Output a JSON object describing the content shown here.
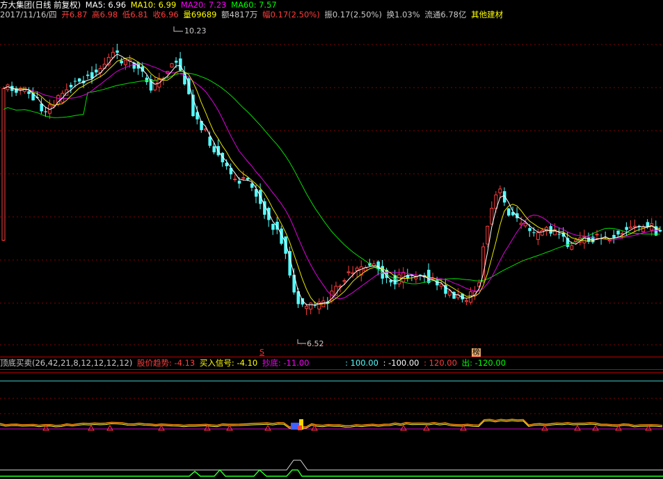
{
  "header": {
    "stock": "方大集团(日线 前复权)",
    "ma5_label": "MA5: 6.96",
    "ma10_label": "MA10: 6.99",
    "ma20_label": "MA20: 7.23",
    "ma60_label": "MA60: 7.57",
    "date": "2017/11/16/四",
    "open_label": "开6.87",
    "high_label": "高6.98",
    "low_label": "低6.81",
    "close_label": "收6.96",
    "volume_label": "量69689",
    "amount_label": "额4817万",
    "change_label": "幅0.17(2.50%)",
    "amplitude_label": "振0.17(2.50%)",
    "turnover_label": "换1.03%",
    "float_label": "流通6.78亿",
    "sector": "其他建材"
  },
  "chart": {
    "high_marker": "10.23",
    "low_marker": "6.52",
    "s_tag": "S",
    "bang_tag": "榜"
  },
  "indicator": {
    "name": "顶底买卖(26,42,21,8,12,12,12,12)",
    "trend_label": "股价趋势: -4.13",
    "buy_signal_label": "买入信号: -4.10",
    "bottom_label": "抄底: -11.00",
    "v1_label": ": 100.00",
    "v2_label": ": -100.00",
    "v3_label": ": 120.00",
    "out_label": "出: -120.00"
  },
  "colors": {
    "up": "#ff3c3c",
    "down": "#54ffff",
    "ma5": "#ffffff",
    "ma10": "#ffff00",
    "ma20": "#ff00ff",
    "ma60": "#00ff00",
    "grid": "#8b0000"
  }
}
